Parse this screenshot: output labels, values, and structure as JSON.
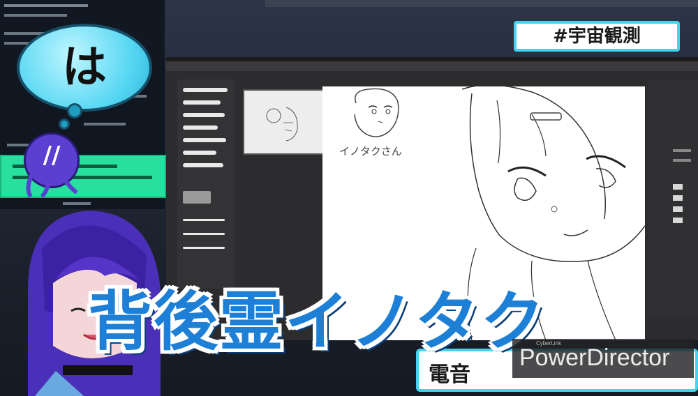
{
  "overlay": {
    "speech_bubble": "は",
    "mascot_face": "//",
    "hashtag": "#宇宙観測",
    "caption": "背後霊イノタク",
    "nameplate": "電音"
  },
  "canvas": {
    "sketch_label": "イノタクさん"
  },
  "watermark": {
    "text": "PowerDirector",
    "subtext": "CyberLink"
  },
  "colors": {
    "caption": "#1e7fd6",
    "bubble": "#54d6f2",
    "chat_highlight": "#27e0a0",
    "badge_border": "#46d3f0",
    "mascot": "#5a3fd0"
  },
  "icons": [
    "speech-bubble",
    "mascot-character",
    "avatar-character"
  ]
}
